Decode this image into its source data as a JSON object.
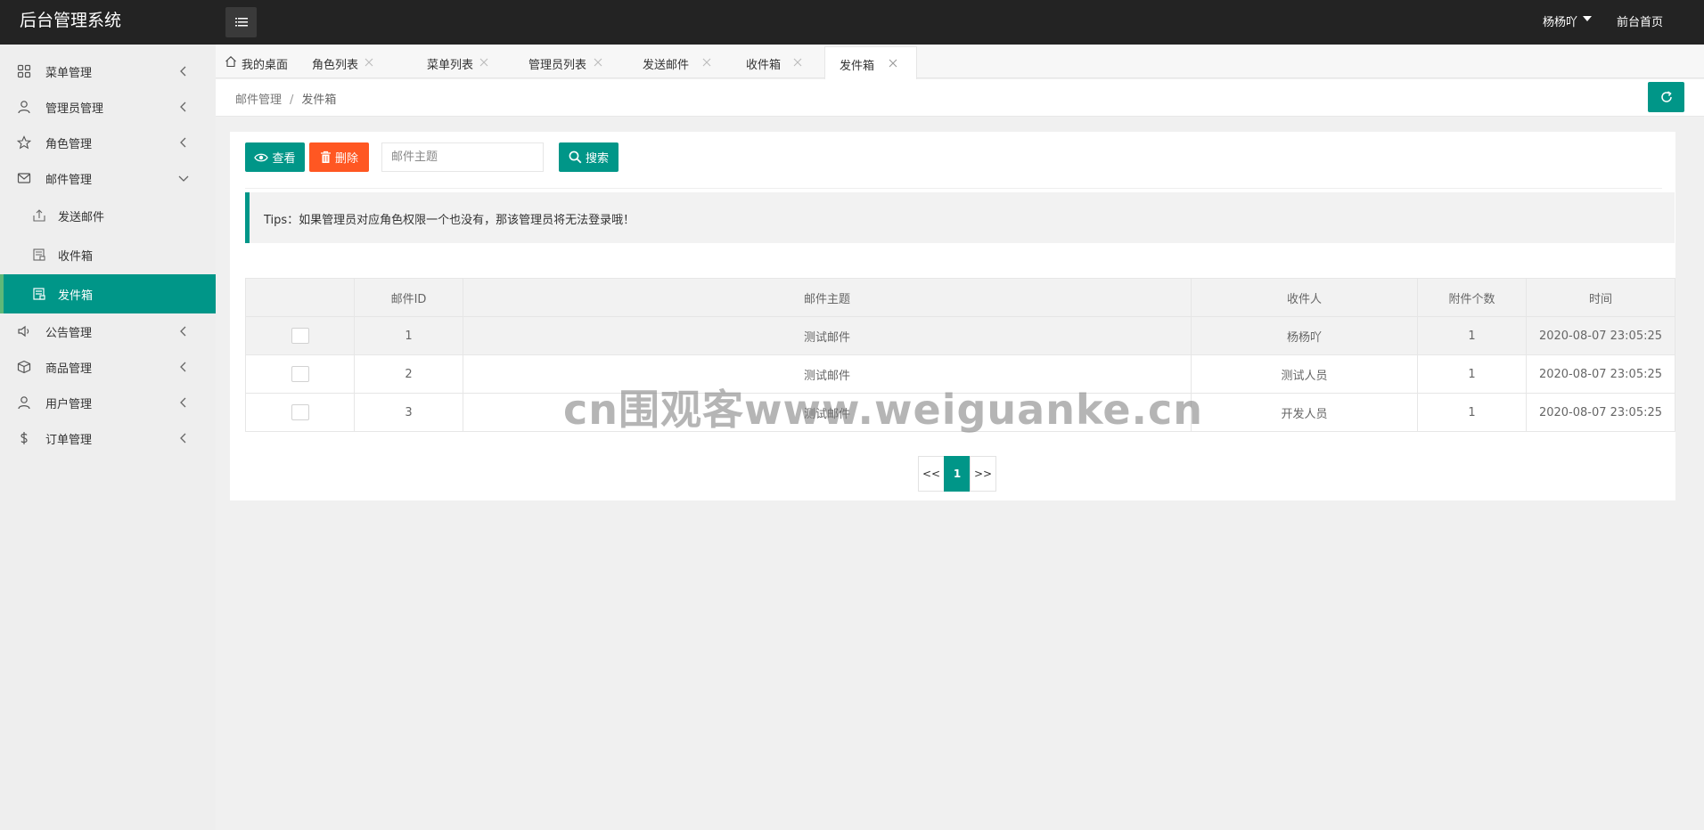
{
  "header": {
    "logo": "后台管理系统",
    "user_name": "杨杨吖",
    "home_link": "前台首页"
  },
  "sidebar": {
    "items": [
      {
        "label": "菜单管理",
        "icon": "grid-icon"
      },
      {
        "label": "管理员管理",
        "icon": "user-icon"
      },
      {
        "label": "角色管理",
        "icon": "star-icon"
      },
      {
        "label": "邮件管理",
        "icon": "mail-icon",
        "expanded": true
      },
      {
        "label": "公告管理",
        "icon": "speaker-icon"
      },
      {
        "label": "商品管理",
        "icon": "box-icon"
      },
      {
        "label": "用户管理",
        "icon": "user-icon"
      },
      {
        "label": "订单管理",
        "icon": "dollar-icon"
      }
    ],
    "mail_sub": [
      {
        "label": "发送邮件",
        "icon": "upload-icon"
      },
      {
        "label": "收件箱",
        "icon": "inbox-icon"
      },
      {
        "label": "发件箱",
        "icon": "outbox-icon",
        "active": true
      }
    ]
  },
  "tabs": [
    {
      "label": "我的桌面",
      "icon": "home-icon"
    },
    {
      "label": "角色列表"
    },
    {
      "label": "菜单列表"
    },
    {
      "label": "管理员列表"
    },
    {
      "label": "发送邮件"
    },
    {
      "label": "收件箱"
    },
    {
      "label": "发件箱",
      "active": true
    }
  ],
  "breadcrumb": {
    "parent": "邮件管理",
    "separator": "/",
    "current": "发件箱"
  },
  "toolbar": {
    "view_label": "查看",
    "delete_label": "删除",
    "search_placeholder": "邮件主题",
    "search_label": "搜索"
  },
  "tips": "Tips：如果管理员对应角色权限一个也没有，那该管理员将无法登录哦！",
  "table": {
    "columns": [
      "",
      "邮件ID",
      "邮件主题",
      "收件人",
      "附件个数",
      "时间"
    ],
    "rows": [
      {
        "id": "1",
        "subject": "测试邮件",
        "recipient": "杨杨吖",
        "attachments": "1",
        "time": "2020-08-07 23:05:25"
      },
      {
        "id": "2",
        "subject": "测试邮件",
        "recipient": "测试人员",
        "attachments": "1",
        "time": "2020-08-07 23:05:25"
      },
      {
        "id": "3",
        "subject": "测试邮件",
        "recipient": "开发人员",
        "attachments": "1",
        "time": "2020-08-07 23:05:25"
      }
    ]
  },
  "pagination": {
    "prev": "<<",
    "current": "1",
    "next": ">>"
  },
  "watermark": "cn围观客www.weiguanke.cn",
  "colors": {
    "primary": "#009688",
    "danger": "#ff5722",
    "header_bg": "#232323"
  }
}
